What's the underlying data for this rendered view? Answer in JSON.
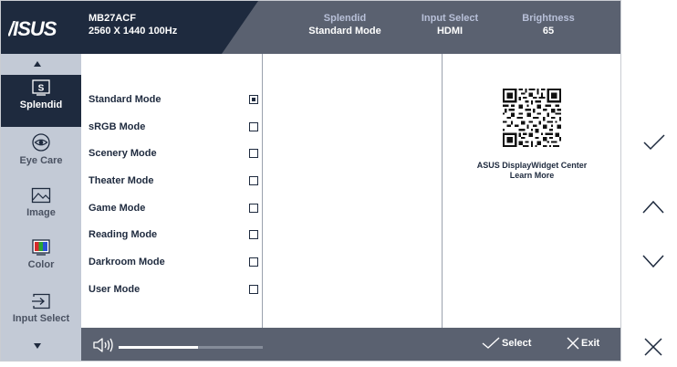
{
  "header": {
    "model": "MB27ACF",
    "resolution": "2560 X 1440 100Hz",
    "status": [
      {
        "key": "Splendid",
        "value": "Standard Mode"
      },
      {
        "key": "Input Select",
        "value": "HDMI"
      },
      {
        "key": "Brightness",
        "value": "65"
      }
    ]
  },
  "sidebar": {
    "items": [
      {
        "label": "Splendid",
        "icon": "splendid-icon",
        "active": true
      },
      {
        "label": "Eye Care",
        "icon": "eye-icon"
      },
      {
        "label": "Image",
        "icon": "image-icon"
      },
      {
        "label": "Color",
        "icon": "color-icon"
      },
      {
        "label": "Input Select",
        "icon": "input-select-icon"
      }
    ]
  },
  "modes": [
    {
      "label": "Standard Mode",
      "selected": true
    },
    {
      "label": "sRGB Mode"
    },
    {
      "label": "Scenery Mode"
    },
    {
      "label": "Theater Mode"
    },
    {
      "label": "Game Mode"
    },
    {
      "label": "Reading Mode"
    },
    {
      "label": "Darkroom Mode"
    },
    {
      "label": "User Mode"
    }
  ],
  "promo": {
    "line1": "ASUS DisplayWidget Center",
    "line2": "Learn More"
  },
  "footer": {
    "volume": 0.55,
    "select_label": "Select",
    "exit_label": "Exit"
  },
  "colors": {
    "dark": "#1e2a3e",
    "gray": "#5a6170",
    "sidebar": "#c3cad6"
  }
}
